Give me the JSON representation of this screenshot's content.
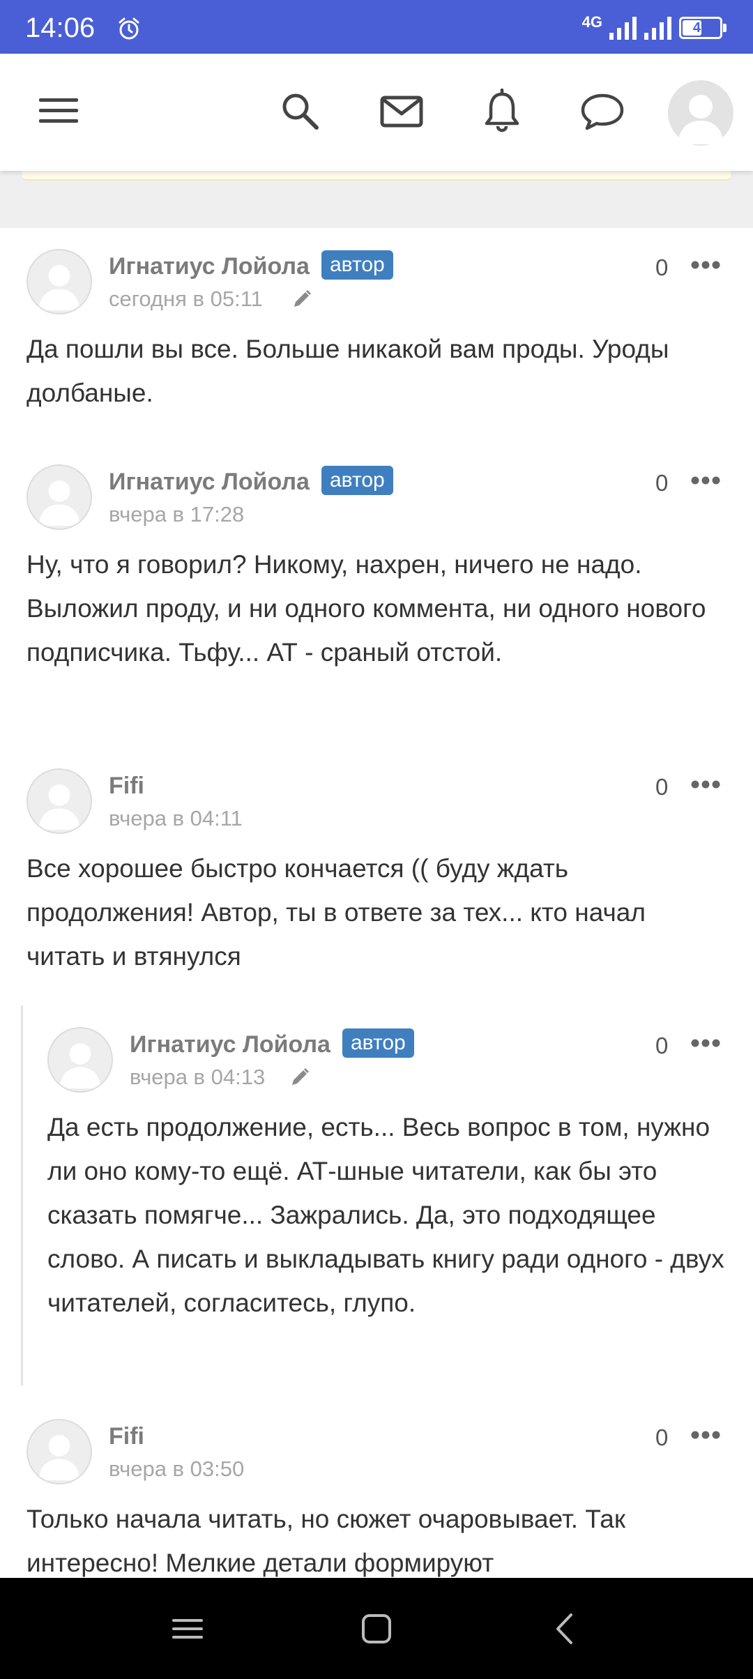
{
  "status_bar": {
    "time": "14:06",
    "network": "4G",
    "battery": "49",
    "battery_fraction": 0.49
  },
  "header": {
    "icons": [
      "menu-icon",
      "search-icon",
      "mail-icon",
      "bell-icon",
      "chat-icon",
      "avatar"
    ]
  },
  "comments": [
    {
      "author": "Игнатиус Лойола",
      "badge": "автор",
      "date": "сегодня в 05:11",
      "edited": true,
      "votes": "0",
      "text": "Да пошли вы все. Больше никакой вам проды. Уроды долбаные."
    },
    {
      "author": "Игнатиус Лойола",
      "badge": "автор",
      "date": "вчера в 17:28",
      "edited": false,
      "votes": "0",
      "text": "Ну, что я говорил? Никому, нахрен, ничего не надо. Выложил проду, и ни одного коммента, ни одного нового подписчика. Тьфу... АТ - сраный отстой."
    },
    {
      "author": "Fifi",
      "badge": "",
      "date": "вчера в 04:11",
      "edited": false,
      "votes": "0",
      "text": "Все хорошее быстро кончается (( буду ждать продолжения! Автор, ты в ответе за тех... кто начал читать и втянулся"
    },
    {
      "author": "Игнатиус Лойола",
      "badge": "автор",
      "date": "вчера в 04:13",
      "edited": true,
      "votes": "0",
      "reply": true,
      "text": "Да есть продолжение, есть... Весь вопрос в том, нужно ли оно кому-то ещё. АТ-шные читатели, как бы это сказать помягче... Зажрались. Да, это подходящее слово.  А писать и выкладывать книгу ради одного - двух читателей, согласитесь, глупо."
    },
    {
      "author": "Fifi",
      "badge": "",
      "date": "вчера в 03:50",
      "edited": false,
      "votes": "0",
      "text": "Только начала читать, но сюжет очаровывает. Так интересно! Мелкие детали формируют"
    }
  ],
  "nav_bar": {
    "icons": [
      "recent-apps-icon",
      "home-icon",
      "back-icon"
    ]
  }
}
